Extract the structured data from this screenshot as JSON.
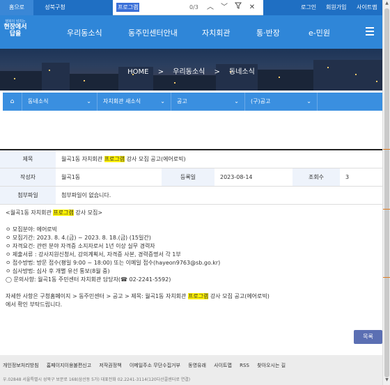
{
  "topbar": {
    "home": "홈으로",
    "gu": "성북구청",
    "login": "로그인",
    "signup": "회원가입",
    "sitemap": "사이트맵"
  },
  "find": {
    "query": "프로그램",
    "count": "0/3"
  },
  "logo": {
    "small": "행복이 넘치는",
    "line1": "현장에서",
    "line2": "답을"
  },
  "nav": {
    "items": [
      "우리동소식",
      "동주민센터안내",
      "자치회관",
      "통·반장",
      "e-민원"
    ]
  },
  "breadcrumb": [
    "HOME",
    ">",
    "우리동소식",
    ">",
    "동네소식"
  ],
  "subnav": {
    "items": [
      "동네소식",
      "자치회관 새소식",
      "공고",
      "(구)공고"
    ]
  },
  "post": {
    "title_label": "제목",
    "title_pre": "월곡1동 자치회관 ",
    "title_hl": "프로그램",
    "title_post": " 강사 모집 공고(에어로빅)",
    "author_label": "작성자",
    "author": "월곡1동",
    "date_label": "등록일",
    "date": "2023-08-14",
    "views_label": "조회수",
    "views": "3",
    "attach_label": "첨부파일",
    "attach": "첨부파일이 없습니다."
  },
  "body": {
    "head_pre": "<월곡1동 자치회관 ",
    "head_hl": "프로그램",
    "head_post": " 강사 모집>",
    "lines": [
      "ㅇ 모집분야: 에어로빅",
      "ㅇ 모집기간: 2023. 8. 4.(금) ~ 2023. 8. 18.(금) (15일간)",
      "ㅇ 자격요건: 관련 분야 자격증 소지자로서 1년 이상 실무 경력자",
      "ㅇ 제출서류 : 강사지원신청서, 강의계획서, 자격증 사본, 경력증명서 각 1부",
      "ㅇ 접수방법: 방문 접수(평일 9:00 ~ 18:00) 또는 이메일 접수(hayeon9763@sb.go.kr)",
      "ㅇ 심사방법: 심사 후 개별 유선 통보(8월 중)",
      "◯ 문의사항: 월곡1동 주민센터 자치회관 담당자(☎ 02-2241-5592)"
    ],
    "detail_pre": "자세한 사항은 구청홈페이지 > 동주민센터 > 공고 > 제목: 월곡1동 자치회관 ",
    "detail_hl": "프로그램",
    "detail_post": " 강사 모집 공고(에어로빅)",
    "detail_end": "에서 확인 부탁드립니다."
  },
  "list_button": "목록",
  "footer": {
    "links": [
      "개인정보처리방침",
      "홈페이지이용불편신고",
      "저작권정책",
      "이메일주소 무단수집거부",
      "동영유래",
      "사이트맵",
      "RSS",
      "찾아오시는 길"
    ],
    "address": "우.02848 서울특별시 성북구 보문로 168(삼선동 5가) 대표전화 02.2241-3114(120다산콜센터로 연결)"
  }
}
